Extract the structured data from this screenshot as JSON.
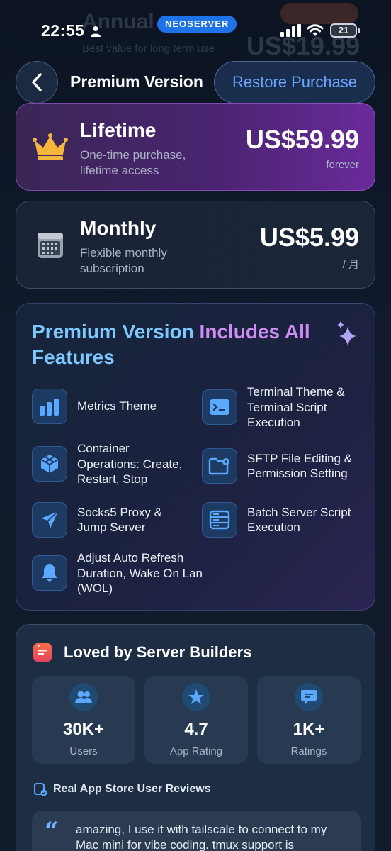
{
  "status_bar": {
    "time": "22:55",
    "app_pill": "NEOSERVER",
    "battery": "21"
  },
  "background_ghost": {
    "title": "Annual",
    "subtitle": "Best value for long term use",
    "price": "US$19.99"
  },
  "header": {
    "title": "Premium Version",
    "restore_label": "Restore Purchase"
  },
  "plans": [
    {
      "name": "Lifetime",
      "description": "One-time purchase, lifetime access",
      "price": "US$59.99",
      "unit": "forever",
      "icon": "crown-icon"
    },
    {
      "name": "Monthly",
      "description": "Flexible monthly subscription",
      "price": "US$5.99",
      "unit": "/ 月",
      "icon": "calendar-icon"
    }
  ],
  "features": {
    "title_part1": "Premium Version ",
    "title_part2": "Includes All",
    "title_part3": "Features",
    "items": [
      {
        "label": "Metrics Theme",
        "icon": "bar-chart-icon"
      },
      {
        "label": "Terminal Theme & Terminal Script Execution",
        "icon": "terminal-icon"
      },
      {
        "label": "Container Operations: Create, Restart, Stop",
        "icon": "container-icon"
      },
      {
        "label": "SFTP File Editing & Permission Setting",
        "icon": "folder-gear-icon"
      },
      {
        "label": "Socks5 Proxy & Jump Server",
        "icon": "paper-plane-icon"
      },
      {
        "label": "Batch Server Script Execution",
        "icon": "server-icon"
      },
      {
        "label": "Adjust Auto Refresh Duration, Wake On Lan (WOL)",
        "icon": "bell-icon"
      }
    ]
  },
  "loved": {
    "title": "Loved by Server Builders",
    "stats": [
      {
        "value": "30K+",
        "label": "Users",
        "icon": "users-icon"
      },
      {
        "value": "4.7",
        "label": "App Rating",
        "icon": "star-icon"
      },
      {
        "value": "1K+",
        "label": "Ratings",
        "icon": "chat-icon"
      }
    ],
    "reviews_heading": "Real App Store User Reviews",
    "review_text": "amazing, I use it with tailscale to connect to my Mac mini for vibe coding. tmux support is"
  },
  "colors": {
    "accent_blue": "#6aa6ff",
    "title_blue": "#7cc8ff",
    "title_purple": "#d08cf2",
    "pill_blue": "#1f73e8"
  }
}
